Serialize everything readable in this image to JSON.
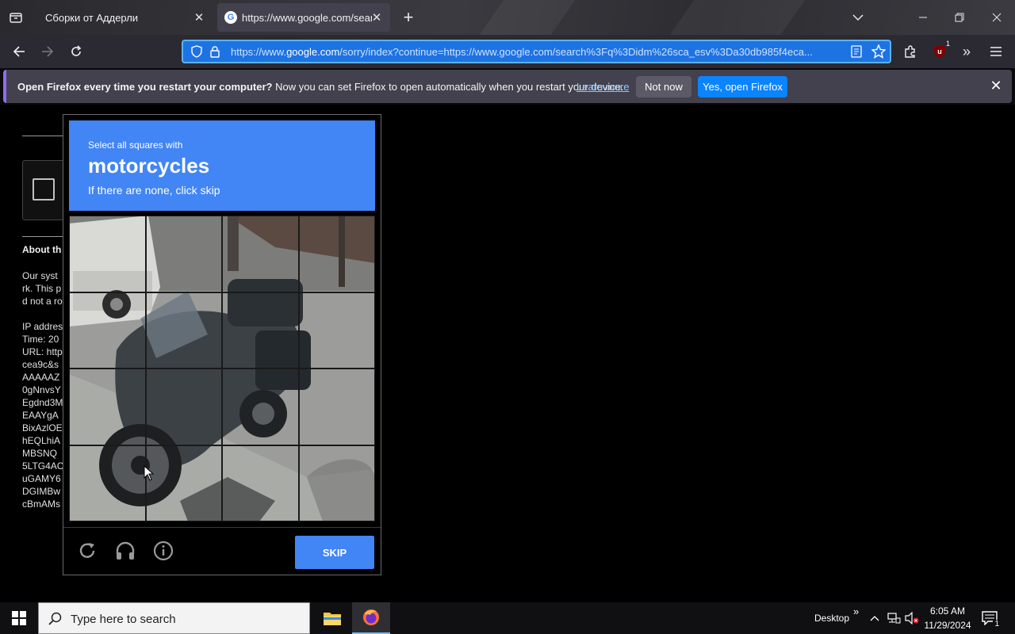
{
  "browser": {
    "tabs": [
      {
        "label": "Сборки от Аддерли"
      },
      {
        "label": "https://www.google.com/search"
      }
    ],
    "url": {
      "prefix": "https://www.",
      "domain": "google.com",
      "rest": "/sorry/index?continue=https://www.google.com/search%3Fq%3Didm%26sca_esv%3Da30db985f4eca..."
    },
    "extension_badge": "1"
  },
  "notification": {
    "bold": "Open Firefox every time you restart your computer?",
    "text": "Now you can set Firefox to open automatically when you restart your device.",
    "link": "Learn more",
    "not_now": "Not now",
    "yes": "Yes, open Firefox"
  },
  "page": {
    "heading": "About th",
    "para": [
      "Our syst",
      "rk. This p",
      "d not a ro"
    ],
    "details": [
      "IP addres",
      "Time: 20",
      "URL: http",
      "cea9c&s",
      "AAAAAZ",
      "0gNnvsY",
      "Egdnd3M",
      "EAAYgA",
      "BixAzlOE",
      "hEQLhiA",
      "MBSNQ",
      "5LTG4AC",
      "uGAMY6",
      "DGIMBw",
      "cBmAMs"
    ]
  },
  "captcha": {
    "instruction": "Select all squares with",
    "target": "motorcycles",
    "hint": "If there are none, click skip",
    "skip_label": "SKIP"
  },
  "taskbar": {
    "search_placeholder": "Type here to search",
    "desktop_label": "Desktop",
    "time": "6:05 AM",
    "date": "11/29/2024",
    "notifications_count": "1"
  },
  "colors": {
    "captcha_blue": "#4285f4",
    "url_highlight": "#1e73e3",
    "firefox_blue": "#0a84ff"
  }
}
